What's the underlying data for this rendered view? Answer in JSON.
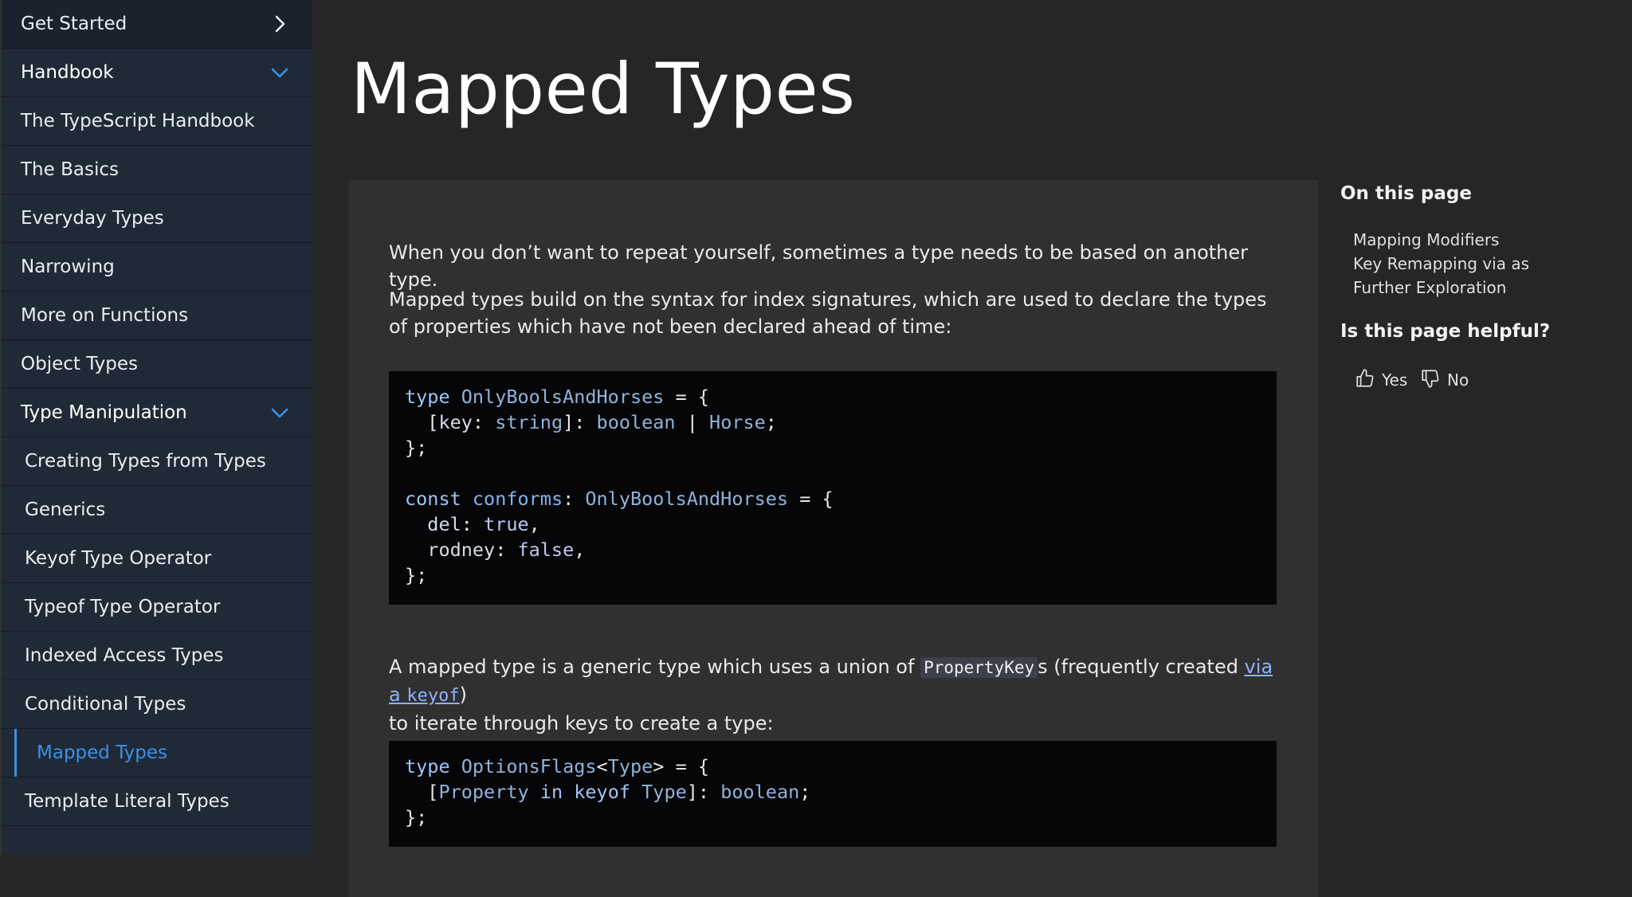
{
  "sidebar": {
    "top_item": "Get Started",
    "handbook_section": "Handbook",
    "handbook_items": [
      "The TypeScript Handbook",
      "The Basics",
      "Everyday Types",
      "Narrowing",
      "More on Functions",
      "Object Types"
    ],
    "type_manip_section": "Type Manipulation",
    "type_manip_items": [
      "Creating Types from Types",
      "Generics",
      "Keyof Type Operator",
      "Typeof Type Operator",
      "Indexed Access Types",
      "Conditional Types"
    ],
    "active_item": "Mapped Types",
    "after_active_item": "Template Literal Types"
  },
  "page": {
    "title": "Mapped Types",
    "intro": "When you don’t want to repeat yourself, sometimes a type needs to be based on another type.",
    "para2": "Mapped types build on the syntax for index signatures, which are used to declare the types of properties which have not been declared ahead of time:",
    "para3_before": "A mapped type is a generic type which uses a union of ",
    "para3_code": "PropertyKey",
    "para3_mid": "s (frequently created ",
    "para3_link_text": "via a ",
    "para3_link_code": "keyof",
    "para3_after": ")",
    "para3_line2": "to iterate through keys to create a type:"
  },
  "toc": {
    "title": "On this page",
    "items": [
      "Mapping Modifiers",
      "Key Remapping via as",
      "Further Exploration"
    ]
  },
  "helpful": {
    "title": "Is this page helpful?",
    "yes": "Yes",
    "no": "No"
  },
  "colors": {
    "accent": "#3d8fe6",
    "sidebar_bg": "#1f2a36",
    "code_bg": "#060608"
  }
}
